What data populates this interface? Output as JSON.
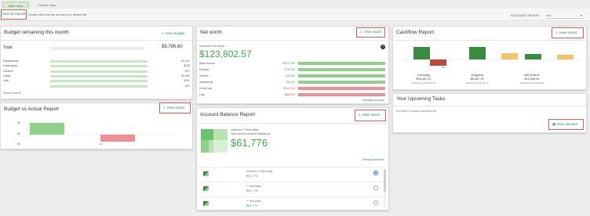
{
  "tabs": {
    "main": "Main View",
    "second": "Tracker View"
  },
  "subbar": {
    "view_all": "View all reports",
    "hint": "Double click this tab and set your default tab",
    "account_group_label": "ACCOUNT GROUP:",
    "account_group_value": "ALL"
  },
  "budget_remaining": {
    "title": "Budget remaining this month",
    "view_label": "View budget",
    "total_label": "Total",
    "total_amount": "$9,796.60",
    "rows": [
      {
        "label": "Repayments",
        "amount": "$1,101"
      },
      {
        "label": "Unassigned",
        "amount": "$225"
      },
      {
        "label": "General",
        "amount": "$72"
      },
      {
        "label": "Living",
        "amount": "$1,084"
      },
      {
        "label": "Help",
        "amount": "$302"
      },
      {
        "label": "",
        "amount": "$41"
      }
    ],
    "show_more": "Show more"
  },
  "budget_vs_actual": {
    "title": "Budget vs Actual Report",
    "view_label": "View report",
    "y_ticks": [
      "$0",
      "$0",
      "$0"
    ],
    "x_label": "Jan"
  },
  "net_worth": {
    "title": "Net worth",
    "view_label": "View report",
    "estimate_label": "Estimated Net Worth",
    "amount": "$123,802.57",
    "help": "?",
    "rows": [
      {
        "label": "Bank Account",
        "amount": "$55,717.88",
        "color": "#8fd18a"
      },
      {
        "label": "Property",
        "amount": "$730,000",
        "color": "#8fd18a"
      },
      {
        "label": "Vehicles",
        "amount": "$13,000",
        "color": "#8fd18a"
      },
      {
        "label": "Investments",
        "amount": "$36,450",
        "color": "#8fd18a"
      },
      {
        "label": "Credit Card",
        "amount": "-$2,417.50",
        "color": "#ef8f8f"
      },
      {
        "label": "Loan",
        "amount": "-$665,000",
        "color": "#ef8f8f"
      }
    ],
    "manage": "Manage accounts"
  },
  "account_balance": {
    "title": "Account Balance Report",
    "view_label": "View report",
    "account_name": "xxxxxxxx ** Hub Initial",
    "subtitle": "Your current account balance is",
    "amount": "$61,776",
    "manage": "Manage accounts",
    "accounts": [
      {
        "name": "xxxxxxxx ** Hub Initial",
        "amount": "$61,776",
        "selected": true
      },
      {
        "name": "** Hub Initial",
        "amount": "$61,776",
        "selected": false
      },
      {
        "name": "** Hub Initial",
        "amount": "$61,776",
        "selected": false
      }
    ]
  },
  "cashflow": {
    "title": "Cashflow Report",
    "view_label": "View report",
    "x_label": "Jan",
    "groups": [
      {
        "label": "Incoming",
        "value": "$26,267.02",
        "avg": "Monthly avg: $26,267.02"
      },
      {
        "label": "Outgoing",
        "value": "$8,447.19",
        "avg": "Monthly avg: $8,447.19"
      },
      {
        "label": "Net Income",
        "value": "$12,349.92",
        "avg": "Monthly avg: $12,349.92"
      }
    ]
  },
  "upcoming": {
    "title": "Your Upcoming Tasks",
    "message": "You haven't created any tasks yet",
    "view_label": "View calendar"
  },
  "colors": {
    "green_dark": "#3a8a3f",
    "green_light": "#8fd18a",
    "red_dark": "#b94a3e",
    "red_light": "#ef8f8f",
    "yellow": "#f5c46a",
    "accent_border": "#e35d5d",
    "link": "#2e8b57"
  }
}
